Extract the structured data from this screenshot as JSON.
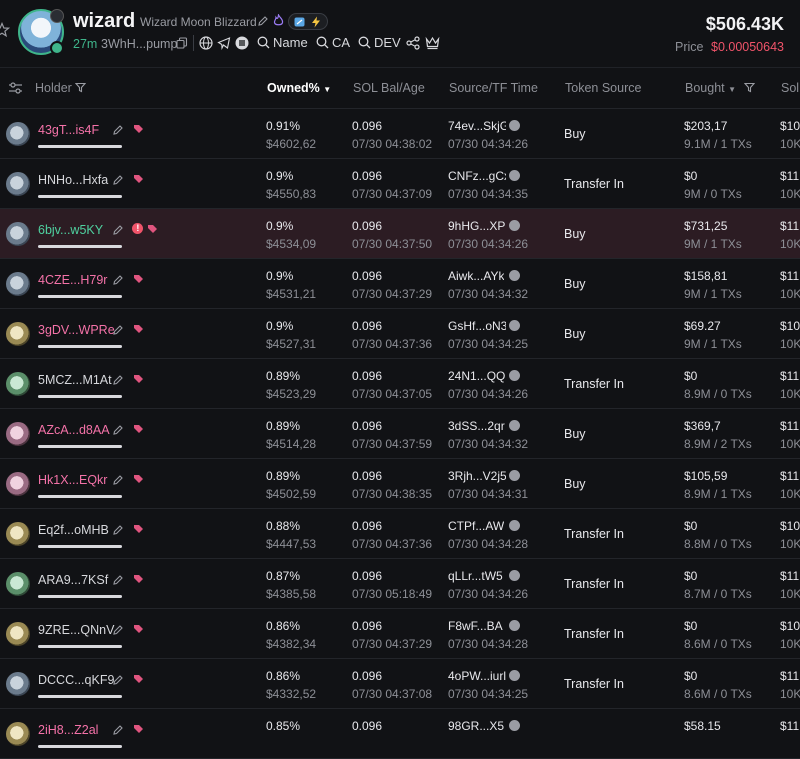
{
  "token": {
    "symbol": "wizard",
    "name": "Wizard Moon Blizzard",
    "age": "27m",
    "address": "3WhH...pump",
    "links": [
      "Name",
      "CA",
      "DEV"
    ],
    "market_cap": "$506.43K",
    "price_label": "Price",
    "price": "$0.00050643"
  },
  "table": {
    "headers": {
      "holder": "Holder",
      "owned": "Owned%",
      "sol_bal": "SOL Bal/Age",
      "source": "Source/TF Time",
      "token_source": "Token Source",
      "bought": "Bought",
      "sold": "Sol"
    },
    "rows": [
      {
        "holder": "43gT...is4F",
        "color": "pink",
        "avatar": "gray",
        "owned": "0.91%",
        "owned_usd": "$4602,62",
        "sol": "0.096",
        "sol_time": "07/30 04:38:02",
        "source": "74ev...SkjG",
        "source_time": "07/30 04:34:26",
        "token_source": "Buy",
        "bought": "$203,17",
        "bought_sub": "9.1M / 1 TXs",
        "sold": "$10",
        "sold_sub": "10K"
      },
      {
        "holder": "HNHo...Hxfa",
        "color": "white",
        "avatar": "gray",
        "owned": "0.9%",
        "owned_usd": "$4550,83",
        "sol": "0.096",
        "sol_time": "07/30 04:37:09",
        "source": "CNFz...gCx",
        "source_time": "07/30 04:34:35",
        "token_source": "Transfer In",
        "bought": "$0",
        "bought_sub": "9M / 0 TXs",
        "sold": "$11",
        "sold_sub": "10K"
      },
      {
        "holder": "6bjv...w5KY",
        "color": "green",
        "avatar": "gray",
        "warn": true,
        "highlight": true,
        "owned": "0.9%",
        "owned_usd": "$4534,09",
        "sol": "0.096",
        "sol_time": "07/30 04:37:50",
        "source": "9hHG...XP1",
        "source_time": "07/30 04:34:26",
        "token_source": "Buy",
        "bought": "$731,25",
        "bought_sub": "9M / 1 TXs",
        "sold": "$11",
        "sold_sub": "10K"
      },
      {
        "holder": "4CZE...H79r",
        "color": "pink",
        "avatar": "gray",
        "owned": "0.9%",
        "owned_usd": "$4531,21",
        "sol": "0.096",
        "sol_time": "07/30 04:37:29",
        "source": "Aiwk...AYk",
        "source_time": "07/30 04:34:32",
        "token_source": "Buy",
        "bought": "$158,81",
        "bought_sub": "9M / 1 TXs",
        "sold": "$11",
        "sold_sub": "10K"
      },
      {
        "holder": "3gDV...WPRe",
        "color": "pink",
        "avatar": "yellow",
        "owned": "0.9%",
        "owned_usd": "$4527,31",
        "sol": "0.096",
        "sol_time": "07/30 04:37:36",
        "source": "GsHf...oN3",
        "source_time": "07/30 04:34:25",
        "token_source": "Buy",
        "bought": "$69.27",
        "bought_sub": "9M / 1 TXs",
        "sold": "$10",
        "sold_sub": "10K"
      },
      {
        "holder": "5MCZ...M1At",
        "color": "white",
        "avatar": "green",
        "owned": "0.89%",
        "owned_usd": "$4523,29",
        "sol": "0.096",
        "sol_time": "07/30 04:37:05",
        "source": "24N1...QQ",
        "source_time": "07/30 04:34:26",
        "token_source": "Transfer In",
        "bought": "$0",
        "bought_sub": "8.9M / 0 TXs",
        "sold": "$11",
        "sold_sub": "10K"
      },
      {
        "holder": "AZcA...d8AA",
        "color": "pink",
        "avatar": "pink",
        "owned": "0.89%",
        "owned_usd": "$4514,28",
        "sol": "0.096",
        "sol_time": "07/30 04:37:59",
        "source": "3dSS...2qr",
        "source_time": "07/30 04:34:32",
        "token_source": "Buy",
        "bought": "$369,7",
        "bought_sub": "8.9M / 2 TXs",
        "sold": "$11",
        "sold_sub": "10K"
      },
      {
        "holder": "Hk1X...EQkr",
        "color": "pink",
        "avatar": "pink",
        "owned": "0.89%",
        "owned_usd": "$4502,59",
        "sol": "0.096",
        "sol_time": "07/30 04:38:35",
        "source": "3Rjh...V2j5",
        "source_time": "07/30 04:34:31",
        "token_source": "Buy",
        "bought": "$105,59",
        "bought_sub": "8.9M / 1 TXs",
        "sold": "$11",
        "sold_sub": "10K"
      },
      {
        "holder": "Eq2f...oMHB",
        "color": "white",
        "avatar": "yellow",
        "owned": "0.88%",
        "owned_usd": "$4447,53",
        "sol": "0.096",
        "sol_time": "07/30 04:37:36",
        "source": "CTPf...AW",
        "source_time": "07/30 04:34:28",
        "token_source": "Transfer In",
        "bought": "$0",
        "bought_sub": "8.8M / 0 TXs",
        "sold": "$10",
        "sold_sub": "10K"
      },
      {
        "holder": "ARA9...7KSf",
        "color": "white",
        "avatar": "green",
        "owned": "0.87%",
        "owned_usd": "$4385,58",
        "sol": "0.096",
        "sol_time": "07/30 05:18:49",
        "source": "qLLr...tW5",
        "source_time": "07/30 04:34:26",
        "token_source": "Transfer In",
        "bought": "$0",
        "bought_sub": "8.7M / 0 TXs",
        "sold": "$11",
        "sold_sub": "10K"
      },
      {
        "holder": "9ZRE...QNnV",
        "color": "white",
        "avatar": "yellow",
        "owned": "0.86%",
        "owned_usd": "$4382,34",
        "sol": "0.096",
        "sol_time": "07/30 04:37:29",
        "source": "F8wF...BA",
        "source_time": "07/30 04:34:28",
        "token_source": "Transfer In",
        "bought": "$0",
        "bought_sub": "8.6M / 0 TXs",
        "sold": "$10",
        "sold_sub": "10K"
      },
      {
        "holder": "DCCC...qKF9",
        "color": "white",
        "avatar": "gray",
        "owned": "0.86%",
        "owned_usd": "$4332,52",
        "sol": "0.096",
        "sol_time": "07/30 04:37:08",
        "source": "4oPW...iurl",
        "source_time": "07/30 04:34:25",
        "token_source": "Transfer In",
        "bought": "$0",
        "bought_sub": "8.6M / 0 TXs",
        "sold": "$11",
        "sold_sub": "10K"
      },
      {
        "holder": "2iH8...Z2al",
        "color": "pink",
        "avatar": "yellow",
        "owned": "0.85%",
        "owned_usd": "",
        "sol": "0.096",
        "sol_time": "",
        "source": "98GR...X5",
        "source_time": "",
        "token_source": "",
        "bought": "$58.15",
        "bought_sub": "",
        "sold": "$11",
        "sold_sub": ""
      }
    ]
  }
}
